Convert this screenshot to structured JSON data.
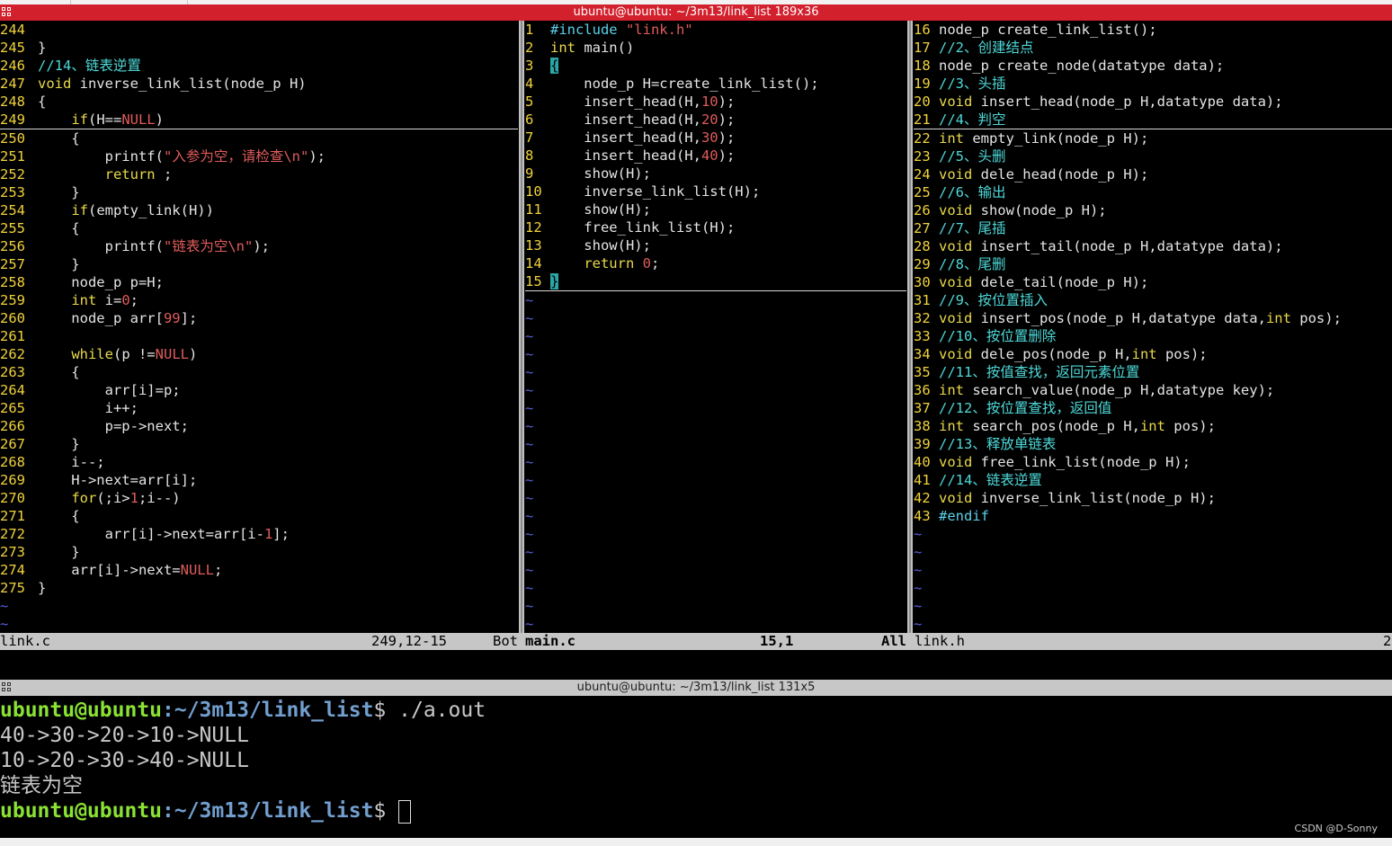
{
  "window1": {
    "title": "ubuntu@ubuntu: ~/3m13/link_list 189x36"
  },
  "window2": {
    "title": "ubuntu@ubuntu: ~/3m13/link_list 131x5"
  },
  "pane1": {
    "lines": [
      {
        "n": "244",
        "t": ""
      },
      {
        "n": "245",
        "t": "}"
      },
      {
        "n": "246",
        "t": "//14、链表逆置"
      },
      {
        "n": "247",
        "t": "void inverse_link_list(node_p H)"
      },
      {
        "n": "248",
        "t": "{"
      },
      {
        "n": "249",
        "t": "    if(H==NULL)"
      },
      {
        "n": "250",
        "t": "    {"
      },
      {
        "n": "251",
        "t": "        printf(\"入参为空，请检查\\n\");"
      },
      {
        "n": "252",
        "t": "        return ;"
      },
      {
        "n": "253",
        "t": "    }"
      },
      {
        "n": "254",
        "t": "    if(empty_link(H))"
      },
      {
        "n": "255",
        "t": "    {"
      },
      {
        "n": "256",
        "t": "        printf(\"链表为空\\n\");"
      },
      {
        "n": "257",
        "t": "    }"
      },
      {
        "n": "258",
        "t": "    node_p p=H;"
      },
      {
        "n": "259",
        "t": "    int i=0;"
      },
      {
        "n": "260",
        "t": "    node_p arr[99];"
      },
      {
        "n": "261",
        "t": ""
      },
      {
        "n": "262",
        "t": "    while(p !=NULL)"
      },
      {
        "n": "263",
        "t": "    {"
      },
      {
        "n": "264",
        "t": "        arr[i]=p;"
      },
      {
        "n": "265",
        "t": "        i++;"
      },
      {
        "n": "266",
        "t": "        p=p->next;"
      },
      {
        "n": "267",
        "t": "    }"
      },
      {
        "n": "268",
        "t": "    i--;"
      },
      {
        "n": "269",
        "t": "    H->next=arr[i];"
      },
      {
        "n": "270",
        "t": "    for(;i>1;i--)"
      },
      {
        "n": "271",
        "t": "    {"
      },
      {
        "n": "272",
        "t": "        arr[i]->next=arr[i-1];"
      },
      {
        "n": "273",
        "t": "    }"
      },
      {
        "n": "274",
        "t": "    arr[i]->next=NULL;"
      },
      {
        "n": "275",
        "t": "}"
      }
    ],
    "tildes": 2
  },
  "pane2": {
    "lines": [
      {
        "n": "1",
        "t": "#include \"link.h\""
      },
      {
        "n": "2",
        "t": "int main()"
      },
      {
        "n": "3",
        "t": "{"
      },
      {
        "n": "4",
        "t": "    node_p H=create_link_list();"
      },
      {
        "n": "5",
        "t": "    insert_head(H,10);"
      },
      {
        "n": "6",
        "t": "    insert_head(H,20);"
      },
      {
        "n": "7",
        "t": "    insert_head(H,30);"
      },
      {
        "n": "8",
        "t": "    insert_head(H,40);"
      },
      {
        "n": "9",
        "t": "    show(H);"
      },
      {
        "n": "10",
        "t": "    inverse_link_list(H);"
      },
      {
        "n": "11",
        "t": "    show(H);"
      },
      {
        "n": "12",
        "t": "    free_link_list(H);"
      },
      {
        "n": "13",
        "t": "    show(H);"
      },
      {
        "n": "14",
        "t": "    return 0;"
      },
      {
        "n": "15",
        "t": "}"
      }
    ],
    "tildes": 19
  },
  "pane3": {
    "lines": [
      {
        "n": "16",
        "t": "node_p create_link_list();"
      },
      {
        "n": "17",
        "t": "//2、创建结点"
      },
      {
        "n": "18",
        "t": "node_p create_node(datatype data);"
      },
      {
        "n": "19",
        "t": "//3、头插"
      },
      {
        "n": "20",
        "t": "void insert_head(node_p H,datatype data);"
      },
      {
        "n": "21",
        "t": "//4、判空"
      },
      {
        "n": "22",
        "t": "int empty_link(node_p H);"
      },
      {
        "n": "23",
        "t": "//5、头删"
      },
      {
        "n": "24",
        "t": "void dele_head(node_p H);"
      },
      {
        "n": "25",
        "t": "//6、输出"
      },
      {
        "n": "26",
        "t": "void show(node_p H);"
      },
      {
        "n": "27",
        "t": "//7、尾插"
      },
      {
        "n": "28",
        "t": "void insert_tail(node_p H,datatype data);"
      },
      {
        "n": "29",
        "t": "//8、尾删"
      },
      {
        "n": "30",
        "t": "void dele_tail(node_p H);"
      },
      {
        "n": "31",
        "t": "//9、按位置插入"
      },
      {
        "n": "32",
        "t": "void insert_pos(node_p H,datatype data,int pos);"
      },
      {
        "n": "33",
        "t": "//10、按位置删除"
      },
      {
        "n": "34",
        "t": "void dele_pos(node_p H,int pos);"
      },
      {
        "n": "35",
        "t": "//11、按值查找，返回元素位置"
      },
      {
        "n": "36",
        "t": "int search_value(node_p H,datatype key);"
      },
      {
        "n": "37",
        "t": "//12、按位置查找，返回值"
      },
      {
        "n": "38",
        "t": "int search_pos(node_p H,int pos);"
      },
      {
        "n": "39",
        "t": "//13、释放单链表"
      },
      {
        "n": "40",
        "t": "void free_link_list(node_p H);"
      },
      {
        "n": "41",
        "t": "//14、链表逆置"
      },
      {
        "n": "42",
        "t": "void inverse_link_list(node_p H);"
      },
      {
        "n": "43",
        "t": "#endif"
      }
    ],
    "tildes": 6
  },
  "status": {
    "pane1_file": "link.c",
    "pane1_pos": "249,12-15",
    "pane1_pct": "Bot",
    "pane2_file": "main.c",
    "pane2_pos": "15,1",
    "pane2_pct": "All",
    "pane3_file": "link.h",
    "pane3_pct": "2"
  },
  "terminal": {
    "user": "ubuntu@ubuntu",
    "path": ":~/3m13/link_list",
    "dollar": "$ ",
    "command": "./a.out",
    "output": [
      "40->30->20->10->NULL",
      "10->20->30->40->NULL",
      "链表为空"
    ]
  },
  "watermark": "CSDN @D-Sonny",
  "colors": {
    "titlebar_active": "#d2202c",
    "titlebar_inactive": "#c7c7c7",
    "line_number": "#f0d23c",
    "keyword": "#e9d94a",
    "comment": "#4ed8d8",
    "string_number": "#e05b5b",
    "prompt_user": "#8ae234",
    "prompt_path": "#729fcf"
  }
}
